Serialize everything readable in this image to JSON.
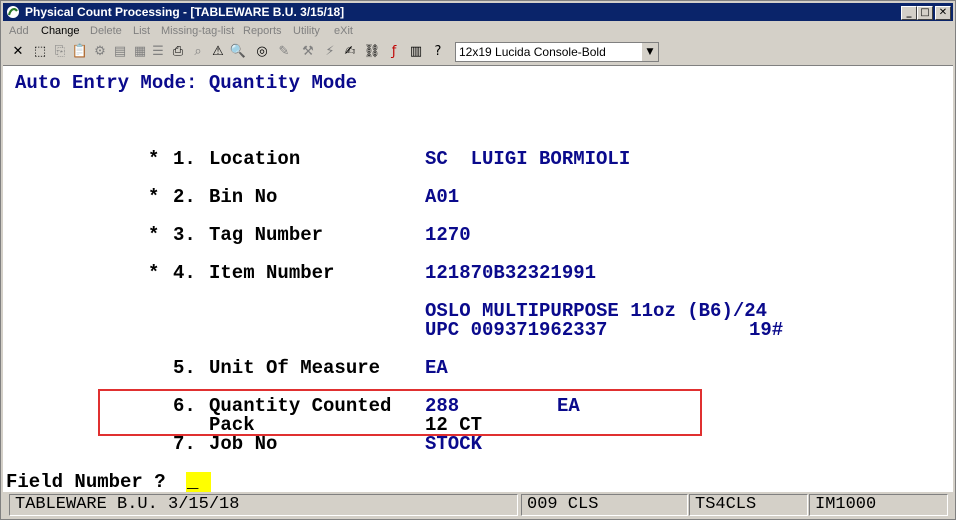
{
  "window": {
    "title": "Physical Count Processing - [TABLEWARE B.U. 3/15/18]",
    "controls": {
      "minimize": "_",
      "maximize": "□",
      "close": "✕"
    }
  },
  "menu": [
    {
      "label": "Add",
      "enabled": false
    },
    {
      "label": "Change",
      "enabled": true
    },
    {
      "label": "Delete",
      "enabled": false
    },
    {
      "label": "List",
      "enabled": false
    },
    {
      "label": "Missing-tag-list",
      "enabled": false
    },
    {
      "label": "Reports",
      "enabled": false
    },
    {
      "label": "Utility",
      "enabled": false
    },
    {
      "label": "eXit",
      "enabled": false
    }
  ],
  "toolbar": {
    "font_select": "12x19 Lucida Console-Bold",
    "dropdown_glyph": "▼"
  },
  "screen": {
    "mode_title": "Auto Entry Mode: Quantity Mode",
    "fields": [
      {
        "marker": "*",
        "num": "1.",
        "label": "Location",
        "value": "SC  LUIGI BORMIOLI"
      },
      {
        "marker": "*",
        "num": "2.",
        "label": "Bin No",
        "value": "A01"
      },
      {
        "marker": "*",
        "num": "3.",
        "label": "Tag Number",
        "value": "1270"
      },
      {
        "marker": "*",
        "num": "4.",
        "label": "Item Number",
        "value": "121870B32321991"
      }
    ],
    "item_desc_line1": "OSLO MULTIPURPOSE 11oz (B6)/24",
    "item_desc_line2": "UPC 009371962337",
    "item_desc_weight": "19#",
    "unit": {
      "num": "5.",
      "label": "Unit Of Measure",
      "value": "EA"
    },
    "qty": {
      "num": "6.",
      "label": "Quantity Counted",
      "value": "288",
      "unit": "EA"
    },
    "pack": {
      "label": "Pack",
      "value": "12 CT"
    },
    "job": {
      "num": "7.",
      "label": "Job No",
      "value": "STOCK"
    },
    "prompt": "Field Number ?",
    "cursor": "_"
  },
  "status": {
    "company": "TABLEWARE B.U. 3/15/18",
    "cls": "009 CLS",
    "code": "TS4CLS",
    "module": "IM1000"
  }
}
